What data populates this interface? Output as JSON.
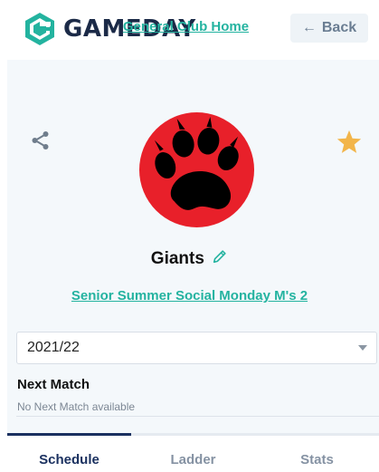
{
  "header": {
    "brand_name": "GAMEDAY",
    "back_label": "Back",
    "back_arrow": "←"
  },
  "club": {
    "home_link": "General Club Home"
  },
  "team": {
    "name": "Giants",
    "logo_icon": "bear-paw-icon",
    "logo_colors": {
      "circle": "#e8202a",
      "paw": "#000000"
    },
    "competition_link": "Senior Summer Social Monday M's 2"
  },
  "actions": {
    "share_icon": "share-icon",
    "favourite_icon": "star-icon",
    "favourite_color": "#f2b54a",
    "edit_icon": "pencil-icon"
  },
  "season": {
    "selected": "2021/22"
  },
  "next_match": {
    "title": "Next Match",
    "empty_text": "No Next Match available"
  },
  "tabs": [
    {
      "label": "Schedule",
      "active": true
    },
    {
      "label": "Ladder",
      "active": false
    },
    {
      "label": "Stats",
      "active": false
    }
  ],
  "colors": {
    "brand_navy": "#1b2a47",
    "brand_teal": "#24b3a0",
    "link": "#24b3a0",
    "active_tab": "#1b3160"
  }
}
